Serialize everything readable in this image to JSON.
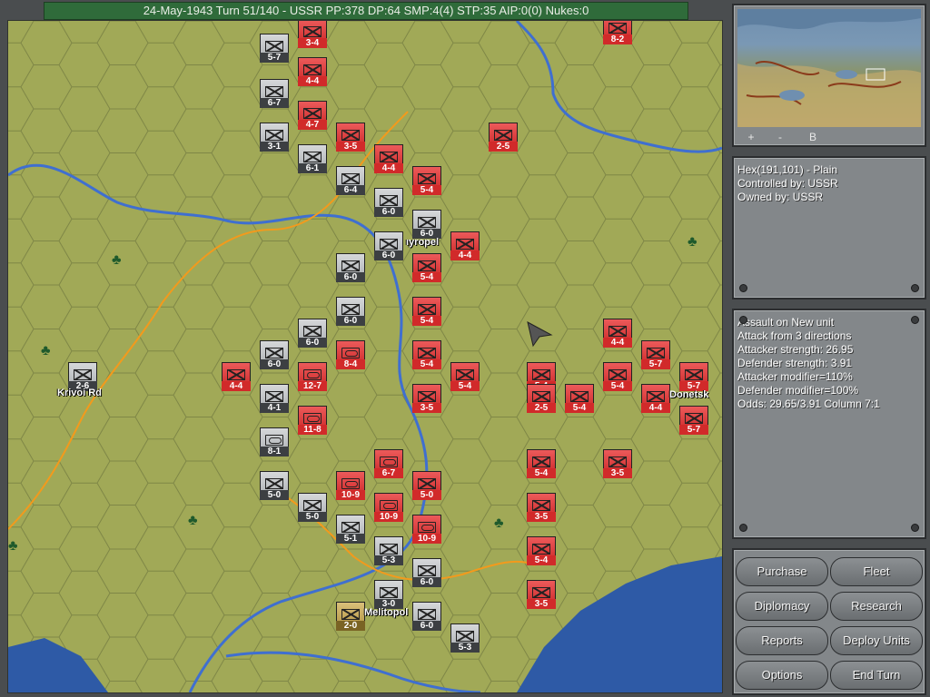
{
  "status_bar": "24-May-1943 Turn 51/140 - USSR PP:378 DP:64 SMP:4(4) STP:35 AIP:0(0) Nukes:0",
  "minimap": {
    "zoom_in": "+",
    "zoom_out": "-",
    "toggle": "B"
  },
  "hex_info": {
    "line1": "Hex(191,101) - Plain",
    "line2": "Controlled by: USSR",
    "line3": "Owned by: USSR"
  },
  "combat_info": {
    "line1": "Assault on New unit",
    "line2": "Attack from 3 directions",
    "line3": "Attacker strength: 26.95",
    "line4": "Defender strength: 3.91",
    "line5": "Attacker modifier=110%",
    "line6": "Defender modifier=100%",
    "line7": "Odds: 29.65/3.91 Column 7:1"
  },
  "buttons": {
    "purchase": "Purchase",
    "fleet": "Fleet",
    "diplomacy": "Diplomacy",
    "research": "Research",
    "reports": "Reports",
    "deploy_units": "Deploy Units",
    "options": "Options",
    "end_turn": "End Turn"
  },
  "cities": {
    "krivoi_rog": "Krivoi Rd",
    "dnepropetrovsk": "ıyropel",
    "melitopol": "Melitopol",
    "donetsk": "Donetsk"
  },
  "units": [
    {
      "side": "ger",
      "type": "inf",
      "label": "5-7"
    },
    {
      "side": "ger",
      "type": "inf",
      "label": "6-7"
    },
    {
      "side": "ger",
      "type": "inf",
      "label": "3-1"
    },
    {
      "side": "ger",
      "type": "inf",
      "label": "6-1"
    },
    {
      "side": "ger",
      "type": "inf",
      "label": "6-4"
    },
    {
      "side": "ger",
      "type": "inf",
      "label": "6-0"
    },
    {
      "side": "ger",
      "type": "inf",
      "label": "6-0"
    },
    {
      "side": "ger",
      "type": "inf",
      "label": "6-0"
    },
    {
      "side": "ger",
      "type": "inf",
      "label": "6-0"
    },
    {
      "side": "ger",
      "type": "inf",
      "label": "6-0"
    },
    {
      "side": "ger",
      "type": "inf",
      "label": "6-0"
    },
    {
      "side": "ger",
      "type": "inf",
      "label": "6-0"
    },
    {
      "side": "ger",
      "type": "inf",
      "label": "2-6"
    },
    {
      "side": "ger",
      "type": "inf",
      "label": "4-1"
    },
    {
      "side": "ger",
      "type": "armor",
      "label": "8-1"
    },
    {
      "side": "ger",
      "type": "inf",
      "label": "5-0"
    },
    {
      "side": "ger",
      "type": "inf",
      "label": "5-0"
    },
    {
      "side": "ger",
      "type": "inf",
      "label": "5-1"
    },
    {
      "side": "ger",
      "type": "inf",
      "label": "5-3"
    },
    {
      "side": "ger",
      "type": "inf",
      "label": "6-0"
    },
    {
      "side": "ger",
      "type": "inf",
      "label": "3-0"
    },
    {
      "side": "ger",
      "type": "inf",
      "label": "6-0"
    },
    {
      "side": "ger",
      "type": "inf",
      "label": "5-3"
    },
    {
      "side": "ally",
      "type": "inf",
      "label": "2-0"
    },
    {
      "side": "sov",
      "type": "inf",
      "label": "3-4"
    },
    {
      "side": "sov",
      "type": "inf",
      "label": "4-4"
    },
    {
      "side": "sov",
      "type": "inf",
      "label": "4-7"
    },
    {
      "side": "sov",
      "type": "inf",
      "label": "3-5"
    },
    {
      "side": "sov",
      "type": "inf",
      "label": "4-4"
    },
    {
      "side": "sov",
      "type": "inf",
      "label": "5-4"
    },
    {
      "side": "sov",
      "type": "inf",
      "label": "2-5"
    },
    {
      "side": "sov",
      "type": "inf",
      "label": "8-2"
    },
    {
      "side": "sov",
      "type": "inf",
      "label": "4-4"
    },
    {
      "side": "sov",
      "type": "inf",
      "label": "5-4"
    },
    {
      "side": "sov",
      "type": "inf",
      "label": "5-4"
    },
    {
      "side": "sov",
      "type": "inf",
      "label": "5-4"
    },
    {
      "side": "sov",
      "type": "inf",
      "label": "4-4"
    },
    {
      "side": "sov",
      "type": "armor",
      "label": "12-7"
    },
    {
      "side": "sov",
      "type": "armor",
      "label": "8-4"
    },
    {
      "side": "sov",
      "type": "armor",
      "label": "11-8"
    },
    {
      "side": "sov",
      "type": "inf",
      "label": "5-4"
    },
    {
      "side": "sov",
      "type": "inf",
      "label": "3-5"
    },
    {
      "side": "sov",
      "type": "inf",
      "label": "5-4"
    },
    {
      "side": "sov",
      "type": "inf",
      "label": "2-5"
    },
    {
      "side": "sov",
      "type": "inf",
      "label": "5-4"
    },
    {
      "side": "sov",
      "type": "inf",
      "label": "4-4"
    },
    {
      "side": "sov",
      "type": "inf",
      "label": "5-7"
    },
    {
      "side": "sov",
      "type": "inf",
      "label": "5-4"
    },
    {
      "side": "sov",
      "type": "inf",
      "label": "4-4"
    },
    {
      "side": "sov",
      "type": "inf",
      "label": "5-7"
    },
    {
      "side": "sov",
      "type": "inf",
      "label": "5-7"
    },
    {
      "side": "sov",
      "type": "armor",
      "label": "6-7"
    },
    {
      "side": "sov",
      "type": "inf",
      "label": "5-0"
    },
    {
      "side": "sov",
      "type": "armor",
      "label": "10-9"
    },
    {
      "side": "sov",
      "type": "armor",
      "label": "10-9"
    },
    {
      "side": "sov",
      "type": "armor",
      "label": "10-9"
    },
    {
      "side": "sov",
      "type": "inf",
      "label": "5-4"
    },
    {
      "side": "sov",
      "type": "inf",
      "label": "3-5"
    },
    {
      "side": "sov",
      "type": "inf",
      "label": "3-5"
    },
    {
      "side": "sov",
      "type": "inf",
      "label": "5-4"
    },
    {
      "side": "sov",
      "type": "inf",
      "label": "3-5"
    }
  ]
}
